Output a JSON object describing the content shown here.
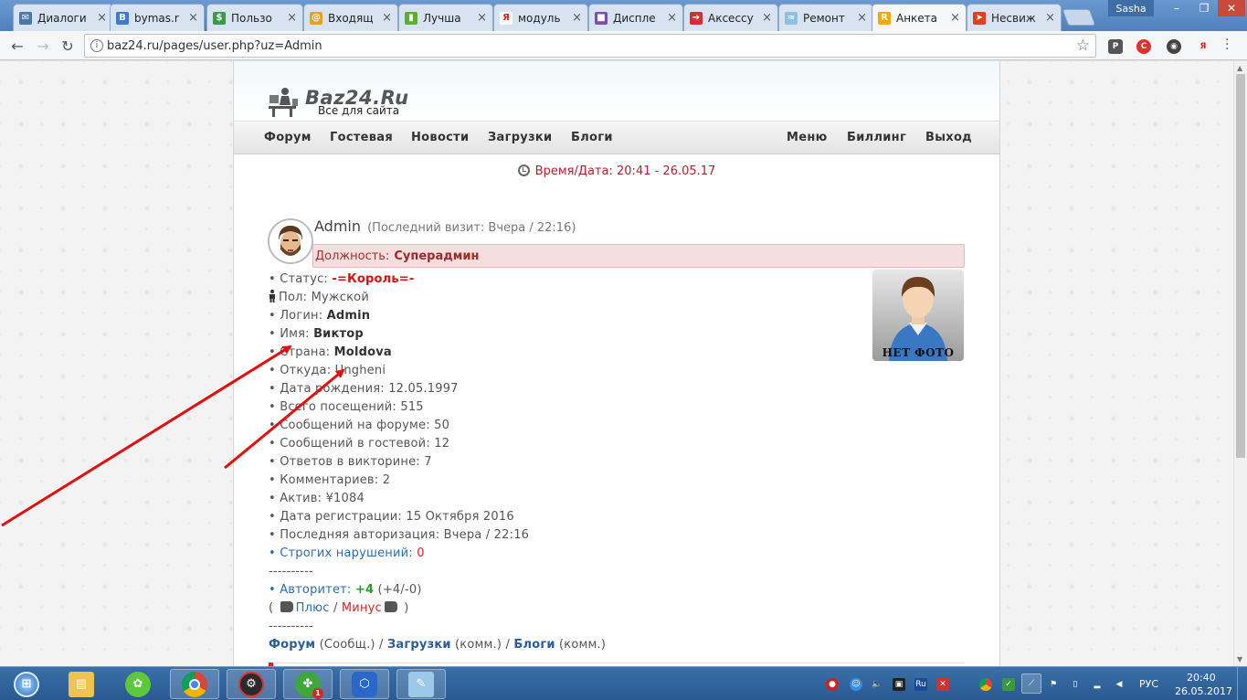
{
  "browser": {
    "tabs": [
      {
        "label": "Диалоги",
        "color": "#4a76a8",
        "glyph": "✉"
      },
      {
        "label": "bymas.r",
        "color": "#3b7bd4",
        "glyph": "B"
      },
      {
        "label": "Пользо",
        "color": "#3a9a4a",
        "glyph": "$"
      },
      {
        "label": "Входящ",
        "color": "#e8a020",
        "glyph": "@"
      },
      {
        "label": "Лучша",
        "color": "#5cb030",
        "glyph": "▮"
      },
      {
        "label": "модуль",
        "color": "#ffffff",
        "glyph": "Я"
      },
      {
        "label": "Диспле",
        "color": "#7b4fb0",
        "glyph": "■"
      },
      {
        "label": "Аксессу",
        "color": "#d23030",
        "glyph": "➔"
      },
      {
        "label": "Ремонт",
        "color": "#8fc0e0",
        "glyph": "≈"
      },
      {
        "label": "Анкета",
        "color": "#f2a900",
        "glyph": "R"
      },
      {
        "label": "Несвиж",
        "color": "#e04020",
        "glyph": "➤"
      }
    ],
    "active_tab_index": 9,
    "user_badge": "Sasha",
    "url": "baz24.ru/pages/user.php?uz=Admin",
    "icons": {
      "back": "arrow-left-icon",
      "forward": "arrow-right-icon",
      "reload": "reload-icon",
      "bookmark": "star-icon"
    }
  },
  "site": {
    "logo_title": "Baz24.Ru",
    "logo_subtitle": "Все для сайта",
    "nav_left": [
      "Форум",
      "Гостевая",
      "Новости",
      "Загрузки",
      "Блоги"
    ],
    "nav_right": [
      "Меню",
      "Биллинг",
      "Выход"
    ],
    "datetime_label": "Время/Дата:",
    "datetime_value": "20:41 - 26.05.17"
  },
  "profile": {
    "username": "Admin",
    "last_visit": "(Последний визит: Вчера / 22:16)",
    "position_label": "Должность:",
    "position_value": "Суперадмин",
    "no_photo_label": "НЕТ ФОТО",
    "fields": {
      "status_label": "• Статус:",
      "status_value": "-=Король=-",
      "gender_label": "Пол:",
      "gender_value": "Мужской",
      "login_label": "• Логин:",
      "login_value": "Admin",
      "name_label": "• Имя:",
      "name_value": "Виктор",
      "country_label": "• Страна:",
      "country_value": "Moldova",
      "from_label": "• Откуда:",
      "from_value": "Ungheni",
      "birth_label": "• Дата рождения:",
      "birth_value": "12.05.1997",
      "visits_label": "• Всего посещений:",
      "visits_value": "515",
      "forum_msgs_label": "• Сообщений на форуме:",
      "forum_msgs_value": "50",
      "guest_msgs_label": "• Сообщений в гостевой:",
      "guest_msgs_value": "12",
      "quiz_label": "• Ответов в викторине:",
      "quiz_value": "7",
      "comments_label": "• Комментариев:",
      "comments_value": "2",
      "assets_label": "• Актив:",
      "assets_currency": "¥",
      "assets_value": "1084",
      "reg_label": "• Дата регистрации:",
      "reg_value": "15 Октября 2016",
      "lastauth_label": "• Последняя авторизация:",
      "lastauth_value": "Вчера / 22:16",
      "violations_label": "• Строгих нарушений:",
      "violations_value": "0",
      "separator": "----------",
      "authority_label": "• Авторитет:",
      "authority_value": "+4",
      "authority_detail": "(+4/-0)",
      "plus_label": "Плюс",
      "minus_label": "Минус",
      "open_paren": "(",
      "close_paren": ")",
      "slash": "/"
    },
    "links": {
      "forum": "Форум",
      "forum_sub": "(Сообщ.)",
      "downloads": "Загрузки",
      "downloads_sub": "(комм.)",
      "blogs": "Блоги",
      "blogs_sub": "(комм.)"
    }
  },
  "taskbar": {
    "language": "РУС",
    "time": "20:40",
    "date": "26.05.2017",
    "notification_badge": "1"
  },
  "colors": {
    "position_bg": "#f4dede",
    "status_red": "#dd1111",
    "link_blue": "#2a6cb0",
    "annotation_arrow": "#e01010"
  }
}
